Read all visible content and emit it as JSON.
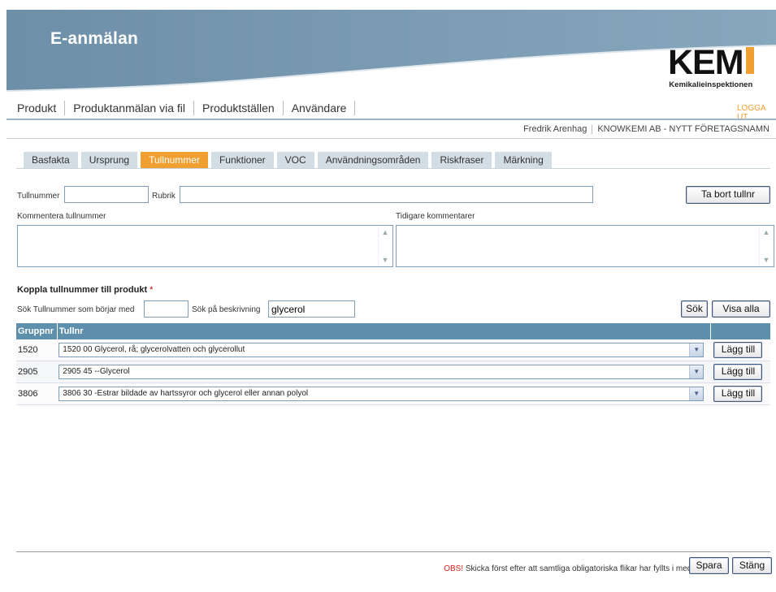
{
  "header": {
    "app_title": "E-anmälan",
    "logo_text": "KEM",
    "logo_sub": "Kemikalieinspektionen"
  },
  "topnav": {
    "items": [
      "Produkt",
      "Produktanmälan via fil",
      "Produktställen",
      "Användare"
    ],
    "logout": "LOGGA UT"
  },
  "user": {
    "name": "Fredrik Arenhag",
    "company": "KNOWKEMI AB - NYTT FÖRETAGSNAMN"
  },
  "tabs": [
    "Basfakta",
    "Ursprung",
    "Tullnummer",
    "Funktioner",
    "VOC",
    "Användningsområden",
    "Riskfraser",
    "Märkning"
  ],
  "active_tab": "Tullnummer",
  "form": {
    "tullnummer_label": "Tullnummer",
    "tullnummer_value": "",
    "rubrik_label": "Rubrik",
    "rubrik_value": "",
    "remove_button": "Ta bort tullnr",
    "comment_label": "Kommentera tullnummer",
    "previous_comments_label": "Tidigare kommentarer"
  },
  "search": {
    "section_title": "Koppla tullnummer till produkt",
    "required_mark": "*",
    "starts_with_label": "Sök Tullnummer som börjar med",
    "starts_with_value": "",
    "description_label": "Sök på beskrivning",
    "description_value": "glycerol",
    "search_button": "Sök",
    "show_all_button": "Visa alla"
  },
  "table": {
    "headers": [
      "Gruppnr",
      "Tullnr"
    ],
    "rows": [
      {
        "group": "1520",
        "tullnr": "1520 00 Glycerol, rå; glycerolvatten och glycerollut",
        "action": "Lägg till"
      },
      {
        "group": "2905",
        "tullnr": "2905 45 --Glycerol",
        "action": "Lägg till"
      },
      {
        "group": "3806",
        "tullnr": "3806 30 -Estrar bildade av hartssyror och glycerol eller annan polyol",
        "action": "Lägg till"
      }
    ]
  },
  "footer": {
    "obs": "OBS!",
    "note": " Skicka först efter att samtliga obligatoriska flikar har fyllts i med info.",
    "save_button": "Spara",
    "close_button": "Stäng"
  },
  "colors": {
    "accent_orange": "#f0a030",
    "header_blue": "#6f93ab",
    "table_header": "#5e8fab"
  }
}
